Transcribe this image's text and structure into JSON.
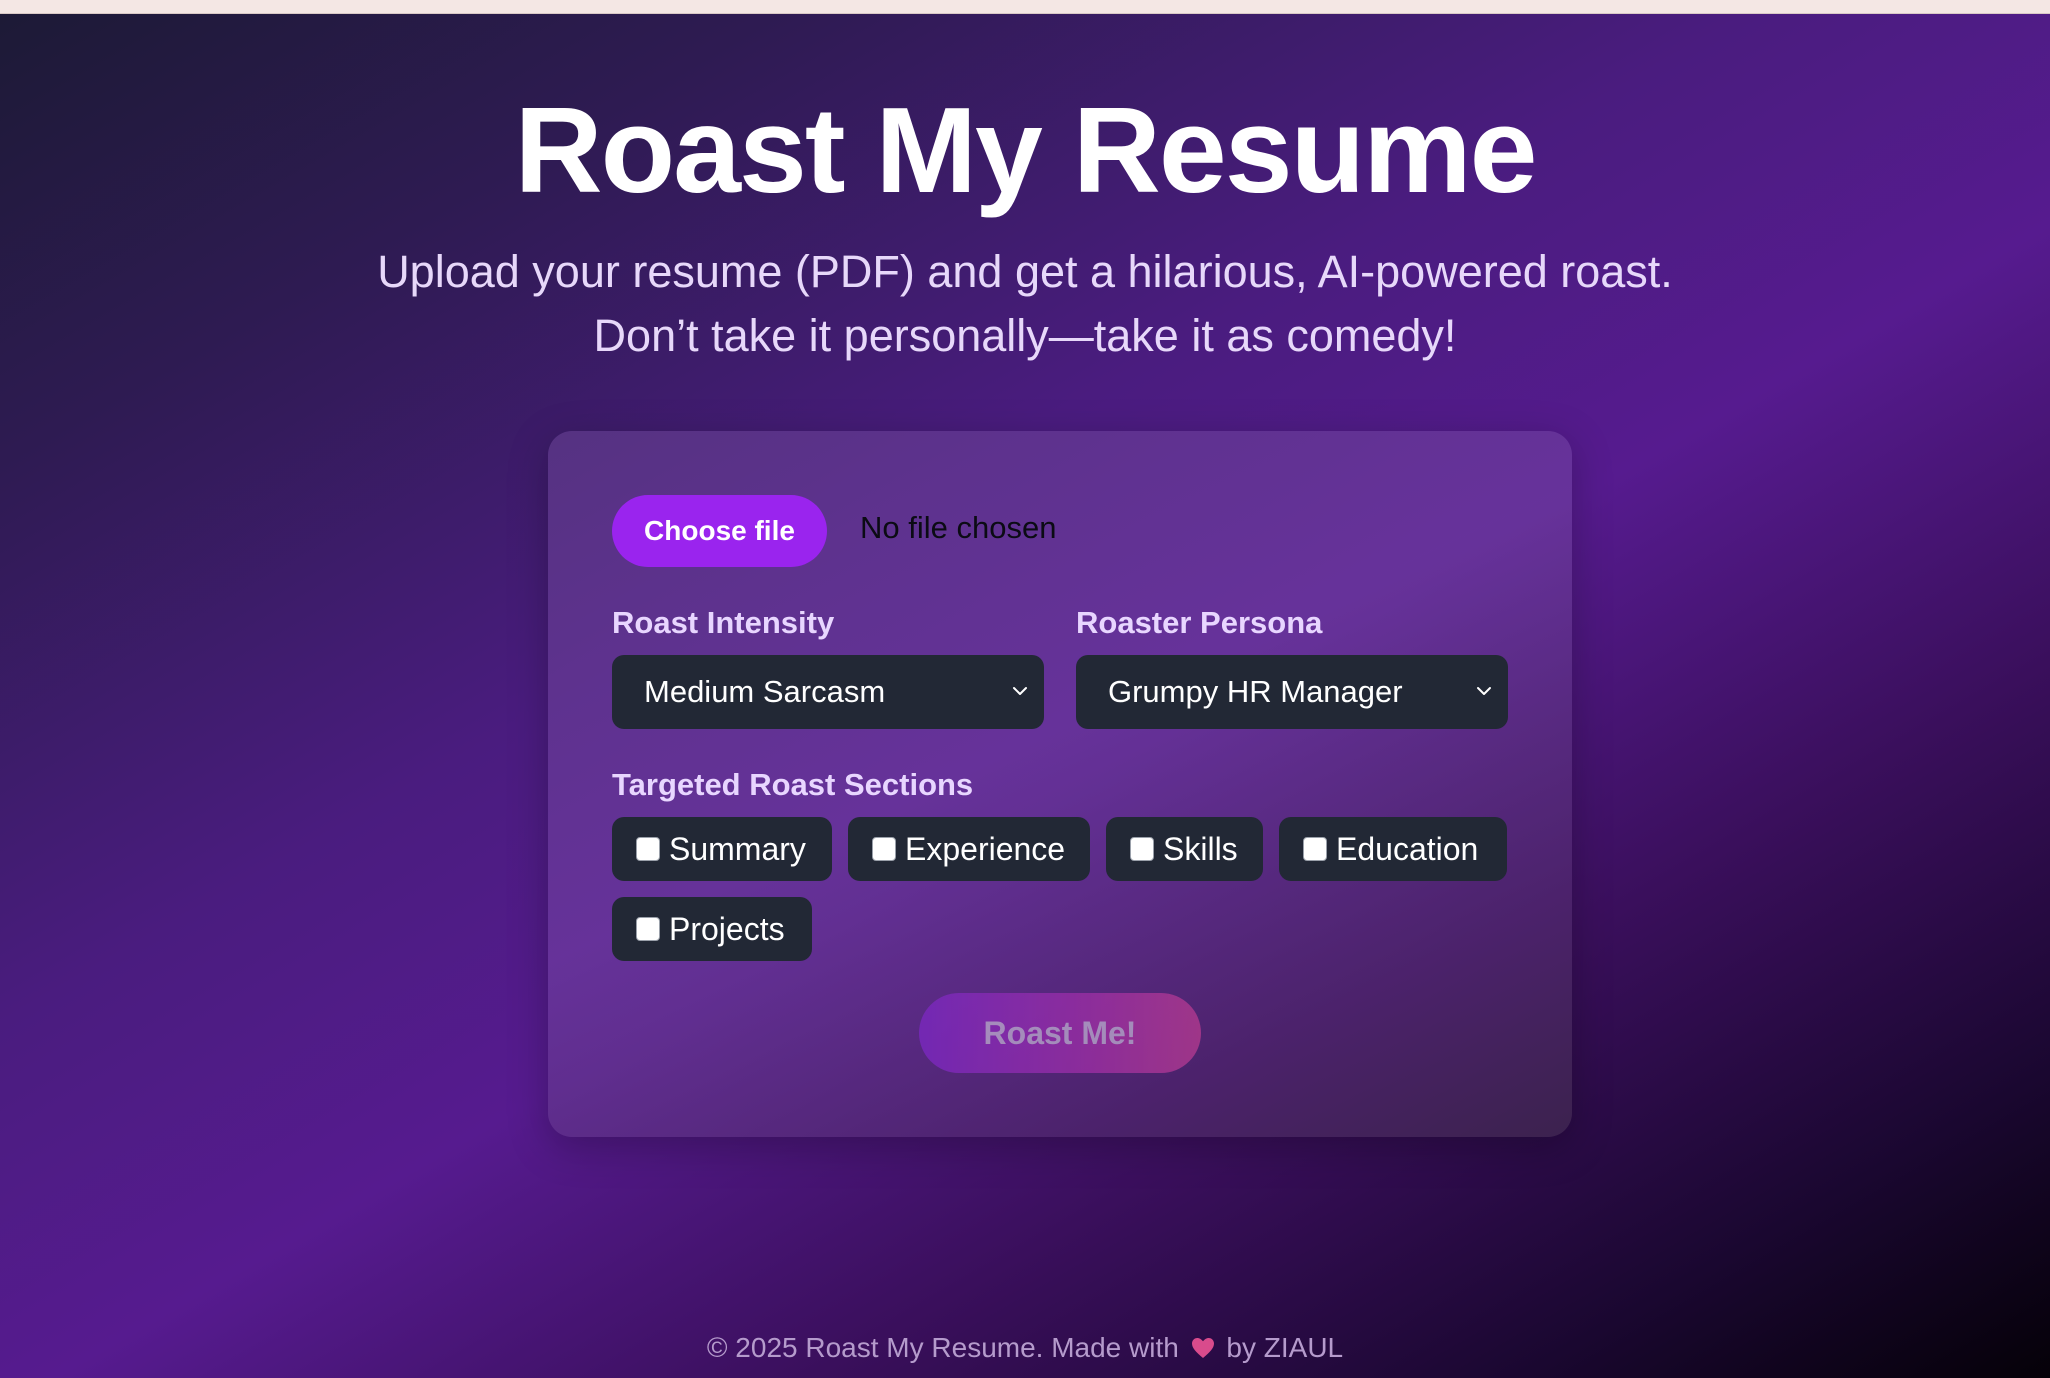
{
  "page": {
    "title": "Roast My Resume",
    "subtitle_line1": "Upload your resume (PDF) and get a hilarious, AI-powered roast.",
    "subtitle_line2": "Don’t take it personally—take it as comedy!"
  },
  "upload": {
    "button_label": "Choose file",
    "status": "No file chosen"
  },
  "intensity": {
    "label": "Roast Intensity",
    "selected": "Medium Sarcasm"
  },
  "persona": {
    "label": "Roaster Persona",
    "selected": "Grumpy HR Manager"
  },
  "sections": {
    "label": "Targeted Roast Sections",
    "items": [
      {
        "label": "Summary",
        "checked": false
      },
      {
        "label": "Experience",
        "checked": false
      },
      {
        "label": "Skills",
        "checked": false
      },
      {
        "label": "Education",
        "checked": false
      },
      {
        "label": "Projects",
        "checked": false
      }
    ]
  },
  "submit": {
    "label": "Roast Me!",
    "disabled": true
  },
  "footer": {
    "text_before": "© 2025 Roast My Resume. Made with",
    "text_after": "by ZIAUL"
  },
  "colors": {
    "accent": "#9a24ee",
    "heart": "#d94b8c",
    "control_bg": "#222835"
  },
  "icons": {
    "select_chevron": "chevron-down-icon",
    "footer_heart": "heart-icon"
  }
}
